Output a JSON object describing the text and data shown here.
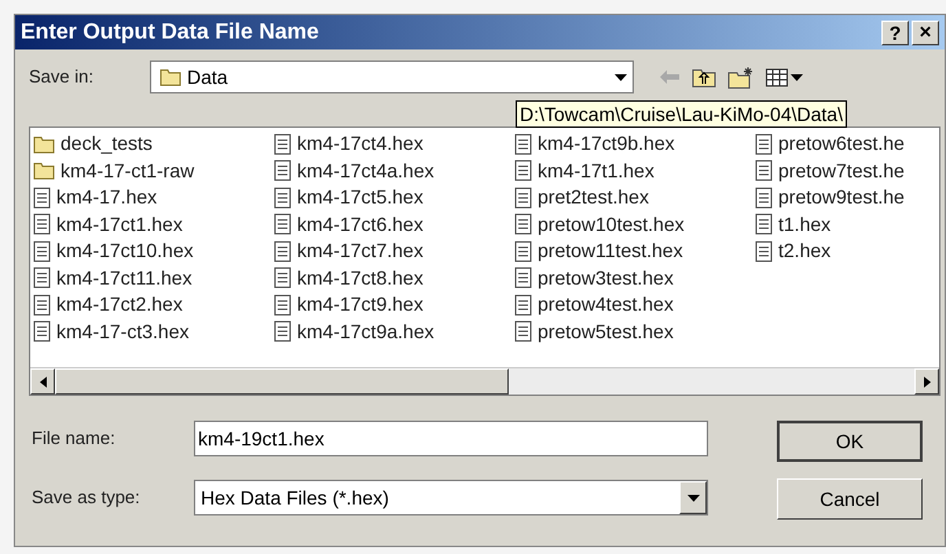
{
  "window": {
    "title": "Enter Output Data File Name",
    "help_button": "?",
    "close_button": "×"
  },
  "save_in": {
    "label": "Save in:",
    "value": "Data"
  },
  "tooltip": "D:\\Towcam\\Cruise\\Lau-KiMo-04\\Data\\",
  "files": [
    [
      {
        "name": "deck_tests",
        "kind": "folder"
      },
      {
        "name": "km4-17-ct1-raw",
        "kind": "folder"
      },
      {
        "name": "km4-17.hex",
        "kind": "file"
      },
      {
        "name": "km4-17ct1.hex",
        "kind": "file"
      },
      {
        "name": "km4-17ct10.hex",
        "kind": "file"
      },
      {
        "name": "km4-17ct11.hex",
        "kind": "file"
      },
      {
        "name": "km4-17ct2.hex",
        "kind": "file"
      },
      {
        "name": "km4-17-ct3.hex",
        "kind": "file"
      }
    ],
    [
      {
        "name": "km4-17ct4.hex",
        "kind": "file"
      },
      {
        "name": "km4-17ct4a.hex",
        "kind": "file"
      },
      {
        "name": "km4-17ct5.hex",
        "kind": "file"
      },
      {
        "name": "km4-17ct6.hex",
        "kind": "file"
      },
      {
        "name": "km4-17ct7.hex",
        "kind": "file"
      },
      {
        "name": "km4-17ct8.hex",
        "kind": "file"
      },
      {
        "name": "km4-17ct9.hex",
        "kind": "file"
      },
      {
        "name": "km4-17ct9a.hex",
        "kind": "file"
      }
    ],
    [
      {
        "name": "km4-17ct9b.hex",
        "kind": "file"
      },
      {
        "name": "km4-17t1.hex",
        "kind": "file"
      },
      {
        "name": "pret2test.hex",
        "kind": "file"
      },
      {
        "name": "pretow10test.hex",
        "kind": "file"
      },
      {
        "name": "pretow11test.hex",
        "kind": "file"
      },
      {
        "name": "pretow3test.hex",
        "kind": "file"
      },
      {
        "name": "pretow4test.hex",
        "kind": "file"
      },
      {
        "name": "pretow5test.hex",
        "kind": "file"
      }
    ],
    [
      {
        "name": "pretow6test.he",
        "kind": "file"
      },
      {
        "name": "pretow7test.he",
        "kind": "file"
      },
      {
        "name": "pretow9test.he",
        "kind": "file"
      },
      {
        "name": "t1.hex",
        "kind": "file"
      },
      {
        "name": "t2.hex",
        "kind": "file"
      }
    ]
  ],
  "file_name": {
    "label": "File name:",
    "value": "km4-19ct1.hex"
  },
  "save_as_type": {
    "label": "Save as type:",
    "value": "Hex Data Files (*.hex)"
  },
  "buttons": [
    "OK",
    "Cancel"
  ]
}
